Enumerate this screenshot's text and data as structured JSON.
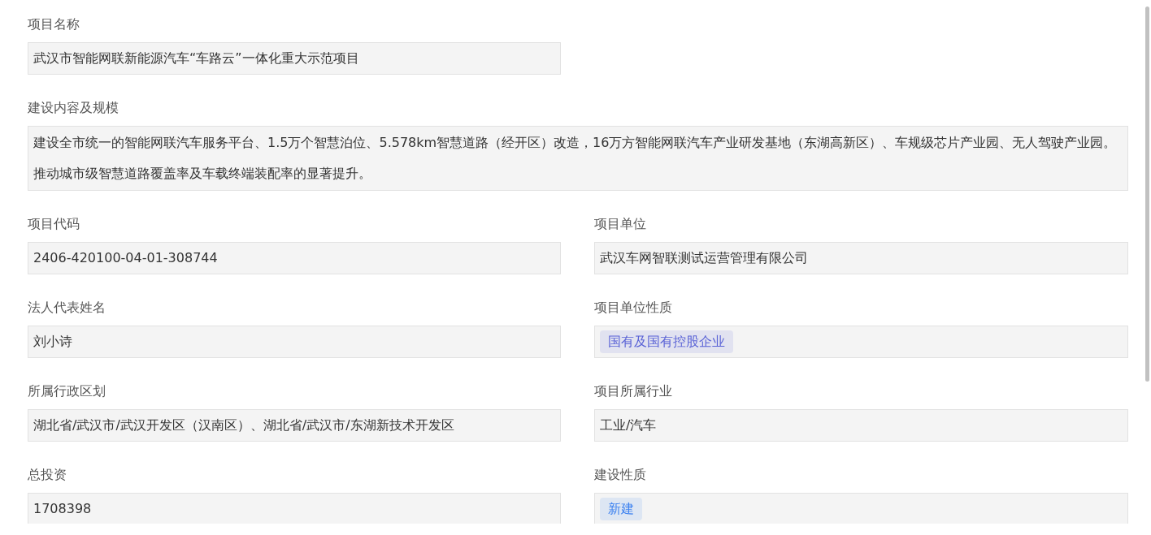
{
  "fields": [
    {
      "label": "项目名称",
      "kind": "text",
      "wide": false,
      "value": "武汉市智能网联新能源汽车“车路云”一体化重大示范项目"
    },
    {
      "label": "建设内容及规模",
      "kind": "text",
      "wide": true,
      "value": "建设全市统一的智能网联汽车服务平台、1.5万个智慧泊位、5.578km智慧道路（经开区）改造，16万方智能网联汽车产业研发基地（东湖高新区）、车规级芯片产业园、无人驾驶产业园。推动城市级智慧道路覆盖率及车载终端装配率的显著提升。"
    },
    {
      "label": "项目代码",
      "kind": "text",
      "wide": false,
      "value": "2406-420100-04-01-308744"
    },
    {
      "label": "项目单位",
      "kind": "text",
      "wide": false,
      "value": "武汉车网智联测试运营管理有限公司"
    },
    {
      "label": "法人代表姓名",
      "kind": "text",
      "wide": false,
      "value": "刘小诗"
    },
    {
      "label": "项目单位性质",
      "kind": "tag",
      "wide": false,
      "value": "国有及国有控股企业",
      "color": "#5a63d6"
    },
    {
      "label": "所属行政区划",
      "kind": "text",
      "wide": false,
      "value": "湖北省/武汉市/武汉开发区（汉南区）、湖北省/武汉市/东湖新技术开发区"
    },
    {
      "label": "项目所属行业",
      "kind": "text",
      "wide": false,
      "value": "工业/汽车"
    },
    {
      "label": "总投资",
      "kind": "text",
      "wide": false,
      "value": "1708398"
    },
    {
      "label": "建设性质",
      "kind": "tag",
      "wide": false,
      "value": "新建",
      "color": "#3d82f0"
    }
  ]
}
